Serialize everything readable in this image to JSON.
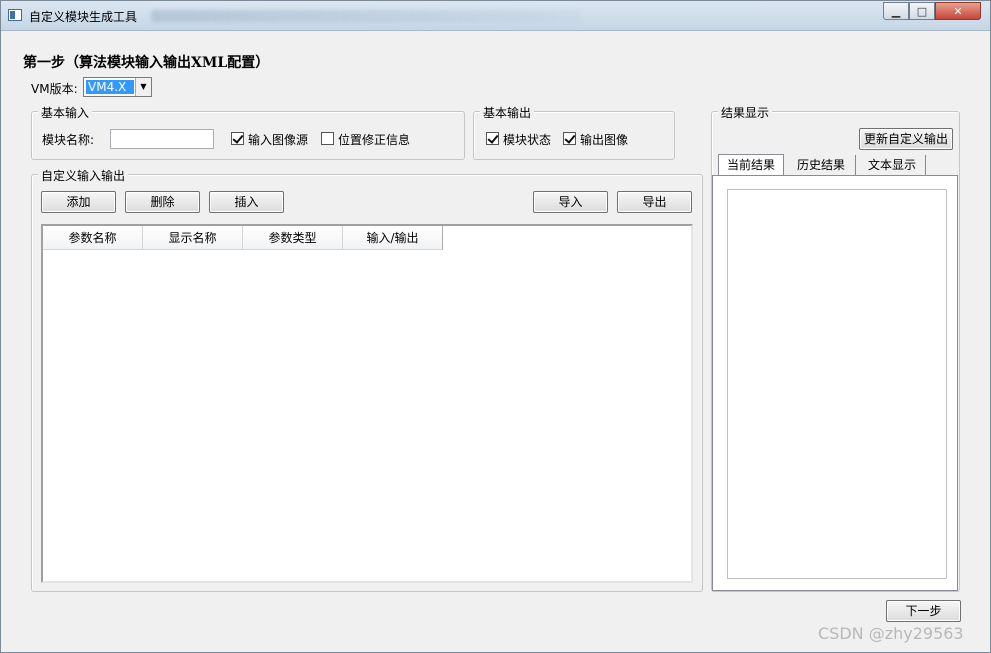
{
  "window": {
    "title": "自定义模块生成工具"
  },
  "header": {
    "step_title": "第一步（算法模块输入输出XML配置）"
  },
  "vm": {
    "label": "VM版本:",
    "value": "VM4.X"
  },
  "basic_input": {
    "title": "基本输入",
    "module_name_label": "模块名称:",
    "module_name_value": "",
    "input_image_source": {
      "label": "输入图像源",
      "checked": true
    },
    "position_correction": {
      "label": "位置修正信息",
      "checked": false
    }
  },
  "basic_output": {
    "title": "基本输出",
    "module_status": {
      "label": "模块状态",
      "checked": true
    },
    "output_image": {
      "label": "输出图像",
      "checked": true
    }
  },
  "custom_io": {
    "title": "自定义输入输出",
    "buttons": {
      "add": "添加",
      "delete": "删除",
      "insert": "插入",
      "import": "导入",
      "export": "导出"
    },
    "columns": [
      "参数名称",
      "显示名称",
      "参数类型",
      "输入/输出"
    ]
  },
  "result": {
    "title": "结果显示",
    "update_button": "更新自定义输出",
    "tabs": [
      "当前结果",
      "历史结果",
      "文本显示"
    ]
  },
  "footer": {
    "next_button": "下一步"
  },
  "watermark": "CSDN @zhy29563"
}
